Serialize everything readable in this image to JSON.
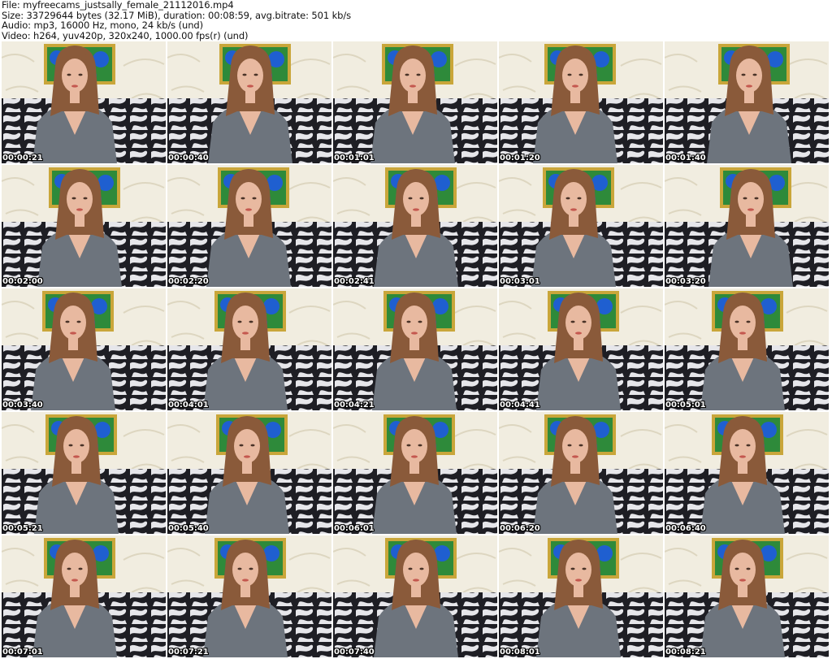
{
  "header": {
    "file_line": "File: myfreecams_justsally_female_21112016.mp4",
    "size_line": "Size: 33729644 bytes (32.17 MiB), duration: 00:08:59, avg.bitrate: 501 kb/s",
    "audio_line": "Audio: mp3, 16000 Hz, mono, 24 kb/s (und)",
    "video_line": "Video: h264, yuv420p, 320x240, 1000.00 fps(r) (und)"
  },
  "thumbnails": [
    {
      "timestamp": "00:00:21"
    },
    {
      "timestamp": "00:00:40"
    },
    {
      "timestamp": "00:01:01"
    },
    {
      "timestamp": "00:01:20"
    },
    {
      "timestamp": "00:01:40"
    },
    {
      "timestamp": "00:02:00"
    },
    {
      "timestamp": "00:02:20"
    },
    {
      "timestamp": "00:02:41"
    },
    {
      "timestamp": "00:03:01"
    },
    {
      "timestamp": "00:03:20"
    },
    {
      "timestamp": "00:03:40"
    },
    {
      "timestamp": "00:04:01"
    },
    {
      "timestamp": "00:04:21"
    },
    {
      "timestamp": "00:04:41"
    },
    {
      "timestamp": "00:05:01"
    },
    {
      "timestamp": "00:05:21"
    },
    {
      "timestamp": "00:05:40"
    },
    {
      "timestamp": "00:06:01"
    },
    {
      "timestamp": "00:06:20"
    },
    {
      "timestamp": "00:06:40"
    },
    {
      "timestamp": "00:07:01"
    },
    {
      "timestamp": "00:07:21"
    },
    {
      "timestamp": "00:07:40"
    },
    {
      "timestamp": "00:08:01"
    },
    {
      "timestamp": "00:08:21"
    }
  ],
  "colors": {
    "wall": "#f1ede0",
    "frame_gold": "#c9a63a",
    "painting_blue": "#1f5fd0",
    "painting_green": "#2e8a3a",
    "sofa_dark": "#1e1e24",
    "sofa_light": "#e6e6ea",
    "hair": "#8a5a3a",
    "skin": "#e8b9a0",
    "sweater": "#6d747d",
    "timestamp_text": "#ffffff"
  }
}
